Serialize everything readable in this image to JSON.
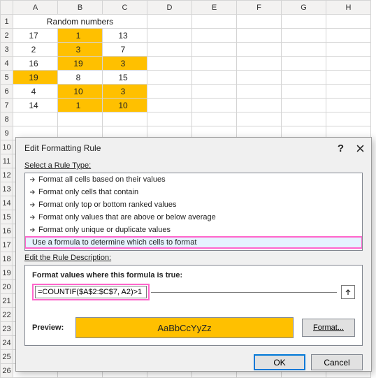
{
  "grid": {
    "columns": [
      "A",
      "B",
      "C",
      "D",
      "E",
      "F",
      "G",
      "H"
    ],
    "row_headers": [
      "1",
      "2",
      "3",
      "4",
      "5",
      "6",
      "7",
      "8",
      "9",
      "10",
      "11",
      "12",
      "13",
      "14",
      "15",
      "16",
      "17",
      "18",
      "19",
      "20",
      "21",
      "22",
      "23",
      "24",
      "25",
      "26"
    ],
    "title_row": {
      "text": "Random numbers"
    },
    "cells": [
      {
        "r": 2,
        "c": "A",
        "v": "17",
        "hl": false
      },
      {
        "r": 2,
        "c": "B",
        "v": "1",
        "hl": true
      },
      {
        "r": 2,
        "c": "C",
        "v": "13",
        "hl": false
      },
      {
        "r": 3,
        "c": "A",
        "v": "2",
        "hl": false
      },
      {
        "r": 3,
        "c": "B",
        "v": "3",
        "hl": true
      },
      {
        "r": 3,
        "c": "C",
        "v": "7",
        "hl": false
      },
      {
        "r": 4,
        "c": "A",
        "v": "16",
        "hl": false
      },
      {
        "r": 4,
        "c": "B",
        "v": "19",
        "hl": true
      },
      {
        "r": 4,
        "c": "C",
        "v": "3",
        "hl": true
      },
      {
        "r": 5,
        "c": "A",
        "v": "19",
        "hl": true
      },
      {
        "r": 5,
        "c": "B",
        "v": "8",
        "hl": false
      },
      {
        "r": 5,
        "c": "C",
        "v": "15",
        "hl": false
      },
      {
        "r": 6,
        "c": "A",
        "v": "4",
        "hl": false
      },
      {
        "r": 6,
        "c": "B",
        "v": "10",
        "hl": true
      },
      {
        "r": 6,
        "c": "C",
        "v": "3",
        "hl": true
      },
      {
        "r": 7,
        "c": "A",
        "v": "14",
        "hl": false
      },
      {
        "r": 7,
        "c": "B",
        "v": "1",
        "hl": true
      },
      {
        "r": 7,
        "c": "C",
        "v": "10",
        "hl": true
      }
    ]
  },
  "dialog": {
    "title": "Edit Formatting Rule",
    "help": "?",
    "section_ruletype": "Select a Rule Type:",
    "rules": [
      "Format all cells based on their values",
      "Format only cells that contain",
      "Format only top or bottom ranked values",
      "Format only values that are above or below average",
      "Format only unique or duplicate values",
      "Use a formula to determine which cells to format"
    ],
    "section_desc": "Edit the Rule Description:",
    "formula_label": "Format values where this formula is true:",
    "formula_value": "=COUNTIF($A$2:$C$7, A2)>1",
    "preview_label": "Preview:",
    "preview_text": "AaBbCcYyZz",
    "format_btn": "Format...",
    "ok": "OK",
    "cancel": "Cancel"
  },
  "colors": {
    "accent_highlight": "#ffc000",
    "pink_outline": "#ff66cc",
    "select_blue": "#e5f3ff"
  }
}
